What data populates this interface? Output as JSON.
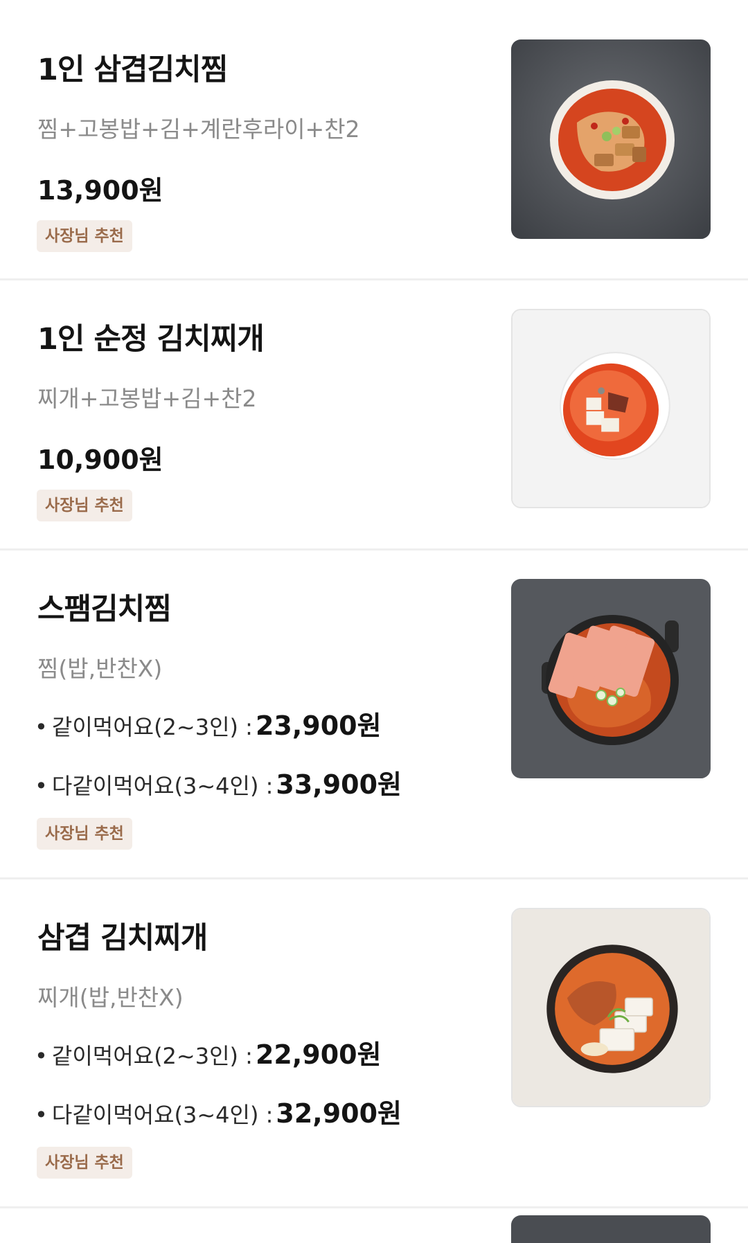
{
  "menu": {
    "items": [
      {
        "title": "1인 삼겹김치찜",
        "desc": "찜+고봉밥+김+계란후라이+찬2",
        "price": "13,900원",
        "badge": "사장님 추천",
        "image_icon": "kimchi-jjim-dish"
      },
      {
        "title": "1인 순정 김치찌개",
        "desc": "찌개+고봉밥+김+찬2",
        "price": "10,900원",
        "badge": "사장님 추천",
        "image_icon": "kimchi-stew-bowl"
      },
      {
        "title": "스팸김치찜",
        "desc": "찜(밥,반찬X)",
        "options": [
          {
            "label": "같이먹어요(2~3인) :",
            "price": "23,900원"
          },
          {
            "label": "다같이먹어요(3~4인) :",
            "price": "33,900원"
          }
        ],
        "badge": "사장님 추천",
        "image_icon": "spam-kimchi-pot"
      },
      {
        "title": "삼겹 김치찌개",
        "desc": "찌개(밥,반찬X)",
        "options": [
          {
            "label": "같이먹어요(2~3인) :",
            "price": "22,900원"
          },
          {
            "label": "다같이먹어요(3~4인) :",
            "price": "32,900원"
          }
        ],
        "badge": "사장님 추천",
        "image_icon": "pork-kimchi-stew-pot"
      }
    ],
    "bullet": "•"
  },
  "colors": {
    "badge_bg": "#f4ede8",
    "badge_text": "#9a6b4b",
    "desc_text": "#8a8a8a",
    "divider": "#efefef"
  }
}
